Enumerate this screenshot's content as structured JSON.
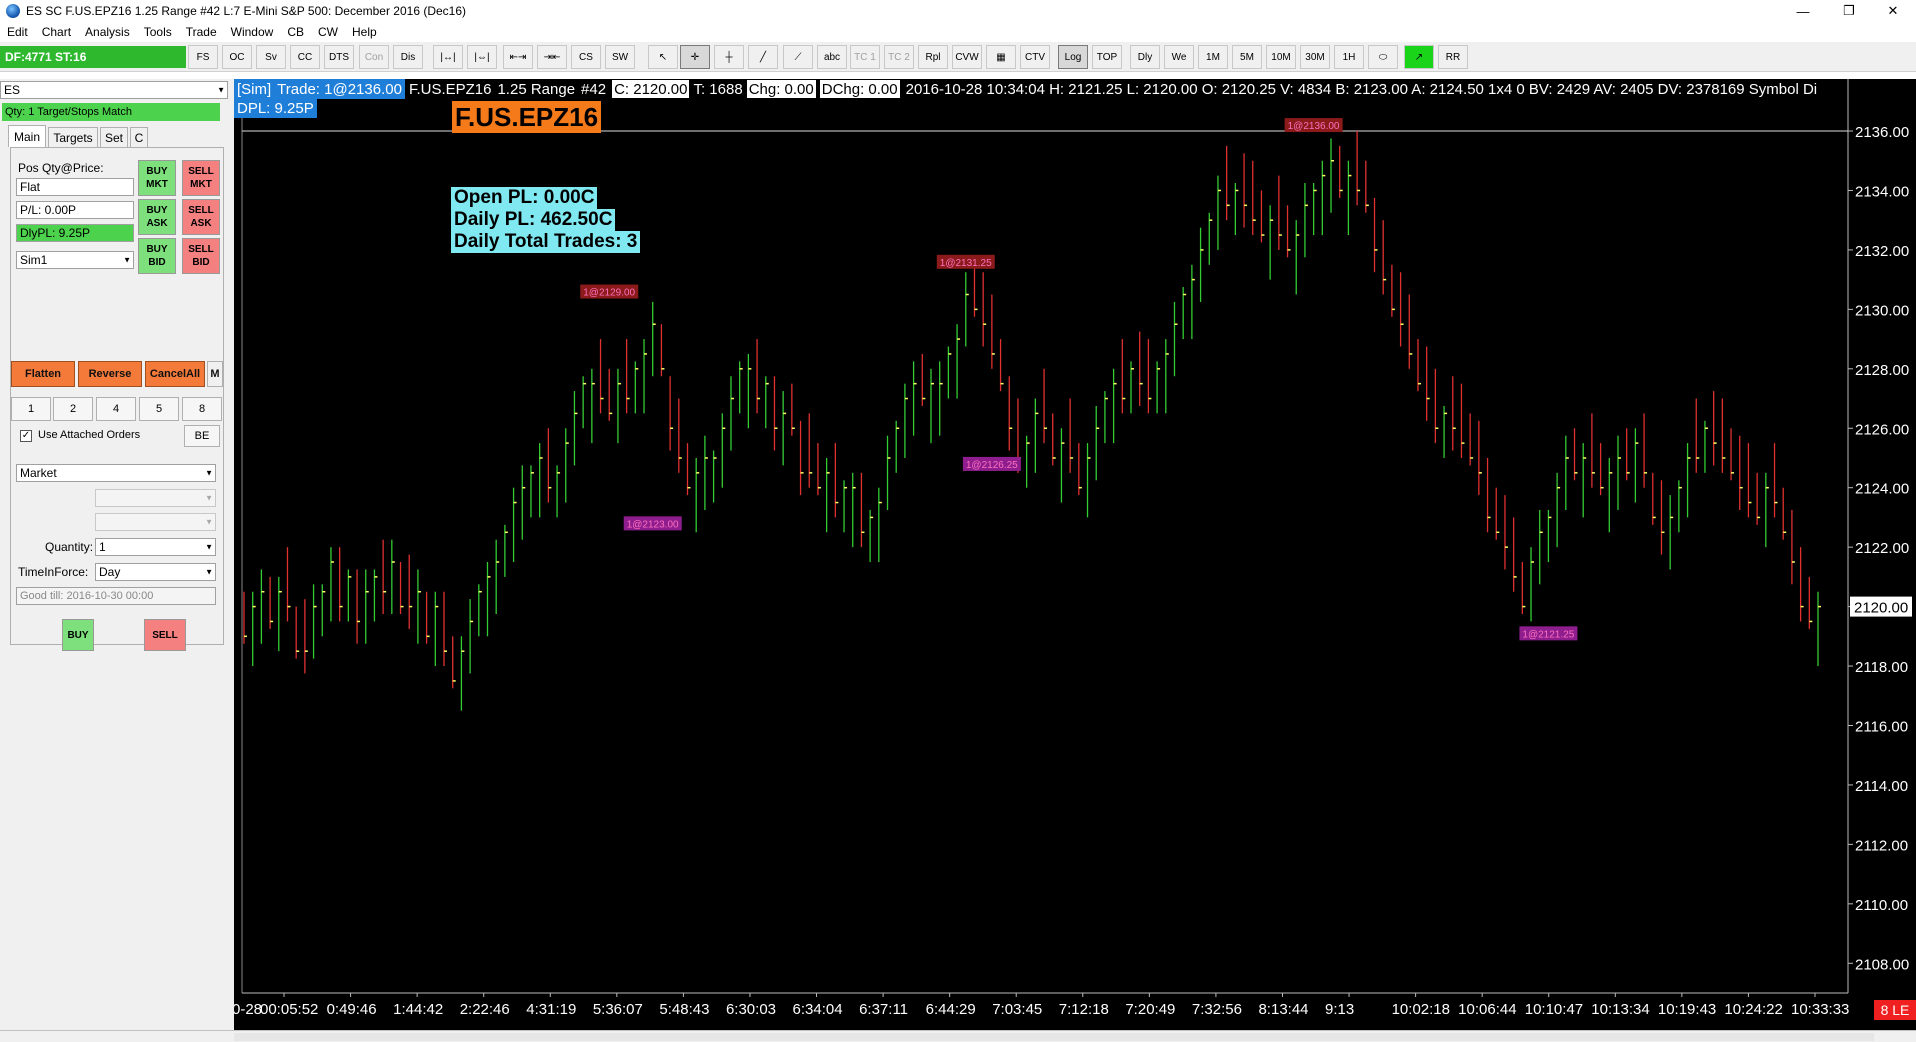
{
  "window": {
    "title": "ES  SC F.US.EPZ16  1.25 Range  #42  L:7  E-Mini S&P 500: December 2016 (Dec16)",
    "controls": [
      "—",
      "❐",
      "✕"
    ]
  },
  "menu": [
    "Edit",
    "Chart",
    "Analysis",
    "Tools",
    "Trade",
    "Window",
    "CB",
    "CW",
    "Help"
  ],
  "toolbar": {
    "status": "DF:4771  ST:16",
    "buttons": [
      {
        "label": "FS",
        "state": "normal"
      },
      {
        "label": "OC",
        "state": "normal"
      },
      {
        "label": "Sv",
        "state": "normal"
      },
      {
        "label": "CC",
        "state": "normal"
      },
      {
        "label": "DTS",
        "state": "normal"
      },
      {
        "label": "Con",
        "state": "disabled"
      },
      {
        "label": "Dis",
        "state": "normal"
      },
      {
        "label": "|↔|",
        "state": "normal"
      },
      {
        "label": "|⇔|",
        "state": "normal"
      },
      {
        "label": "⇤⇥",
        "state": "normal"
      },
      {
        "label": "⇥⇤",
        "state": "normal"
      },
      {
        "label": "CS",
        "state": "normal"
      },
      {
        "label": "SW",
        "state": "normal"
      },
      {
        "label": "↖",
        "state": "normal"
      },
      {
        "label": "✛",
        "state": "active"
      },
      {
        "label": "┼",
        "state": "normal"
      },
      {
        "label": "╱",
        "state": "normal"
      },
      {
        "label": "⟋",
        "state": "normal"
      },
      {
        "label": "abc",
        "state": "normal"
      },
      {
        "label": "TC 1",
        "state": "disabled"
      },
      {
        "label": "TC 2",
        "state": "disabled"
      },
      {
        "label": "Rpl",
        "state": "normal"
      },
      {
        "label": "CVW",
        "state": "normal"
      },
      {
        "label": "▦",
        "state": "normal"
      },
      {
        "label": "CTV",
        "state": "normal"
      },
      {
        "label": "Log",
        "state": "active"
      },
      {
        "label": "TOP",
        "state": "normal"
      },
      {
        "label": "Dly",
        "state": "normal"
      },
      {
        "label": "We",
        "state": "normal"
      },
      {
        "label": "1M",
        "state": "normal"
      },
      {
        "label": "5M",
        "state": "normal"
      },
      {
        "label": "10M",
        "state": "normal"
      },
      {
        "label": "30M",
        "state": "normal"
      },
      {
        "label": "1H",
        "state": "normal"
      },
      {
        "label": "⬭",
        "state": "normal"
      },
      {
        "label": "↗",
        "state": "green"
      },
      {
        "label": "RR",
        "state": "normal"
      }
    ]
  },
  "trade_panel": {
    "symbol": "ES",
    "match_status": "Qty: 1 Target/Stops Match",
    "tabs": [
      "Main",
      "Targets",
      "Set",
      "C"
    ],
    "pos_label": "Pos Qty@Price:",
    "pos_value": "Flat",
    "pl_value": "P/L: 0.00P",
    "dly_pl": "DlyPL: 9.25P",
    "account": "Sim1",
    "order_buttons": {
      "buy_mkt": "BUY\nMKT",
      "sell_mkt": "SELL\nMKT",
      "buy_ask": "BUY\nASK",
      "sell_ask": "SELL\nASK",
      "buy_bid": "BUY\nBID",
      "sell_bid": "SELL\nBID"
    },
    "flatten": "Flatten",
    "reverse": "Reverse",
    "cancel_all": "CancelAll",
    "m_label": "M",
    "qty_buttons": [
      "1",
      "2",
      "4",
      "5",
      "8"
    ],
    "use_attached_label": "Use Attached Orders",
    "use_attached_checked": true,
    "be_label": "BE",
    "order_type": "Market",
    "quantity_label": "Quantity:",
    "quantity_value": "1",
    "tif_label": "TimeInForce:",
    "tif_value": "Day",
    "good_till": "Good till: 2016-10-30 00:00",
    "buy": "BUY",
    "sell": "SELL"
  },
  "chart_header": {
    "sim": "[Sim]",
    "trade": "Trade: 1@2136.00",
    "symbol_text": "F.US.EPZ16",
    "range": "1.25 Range",
    "bars": "#42",
    "close": "C: 2120.00",
    "ticks": "T: 1688",
    "chg": "Chg: 0.00",
    "dchg": "DChg: 0.00",
    "rest": "2016-10-28 10:34:04  H: 2121.25  L: 2120.00  O: 2120.25  V: 4834  B: 2123.00  A: 2124.50  1x4 0  BV: 2429  AV: 2405  DV: 2378169  Symbol Di",
    "dpl": "DPL: 9.25P",
    "symbol_label": "F.US.EPZ16",
    "open_pl": "Open PL: 0.00C",
    "daily_pl": "Daily PL: 462.50C",
    "daily_trades": "Daily Total Trades: 3",
    "corner": "8 LE"
  },
  "chart_data": {
    "type": "bar",
    "y_ticks": [
      "2136.00",
      "2134.00",
      "2132.00",
      "2130.00",
      "2128.00",
      "2126.00",
      "2124.00",
      "2122.00",
      "2120.00",
      "2118.00",
      "2116.00",
      "2114.00",
      "2112.00",
      "2110.00",
      "2108.00"
    ],
    "ylim": [
      2107,
      2137.75
    ],
    "price_line": 2136.0,
    "x_ticks": [
      "0-28",
      "00:05:52",
      "0:49:46",
      "1:44:42",
      "2:22:46",
      "4:31:19",
      "5:36:07",
      "5:48:43",
      "6:30:03",
      "6:34:04",
      "6:37:11",
      "6:44:29",
      "7:03:45",
      "7:12:18",
      "7:20:49",
      "7:32:56",
      "8:13:44",
      "9:13",
      "10:02:18",
      "10:06:44",
      "10:10:47",
      "10:13:34",
      "10:19:43",
      "10:24:22",
      "10:33:33"
    ],
    "colors": {
      "up": "#33cc33",
      "down": "#e03030",
      "sell_tag": "#8b1a1a",
      "buy_tag": "#8e1e8e"
    },
    "closes": [
      2119,
      2120,
      2120.5,
      2119.5,
      2120.5,
      2120,
      2118.5,
      2118.5,
      2120,
      2120.5,
      2121.5,
      2120,
      2121,
      2119.5,
      2120.5,
      2121,
      2120.5,
      2121.5,
      2120,
      2120,
      2120.5,
      2119,
      2120,
      2118.5,
      2117.5,
      2118.5,
      2119.5,
      2120.5,
      2121,
      2121.5,
      2122.5,
      2123.5,
      2124,
      2124.5,
      2125,
      2124,
      2124.5,
      2125.5,
      2126.5,
      2127.5,
      2127.5,
      2127,
      2126.5,
      2127.5,
      2127,
      2128,
      2128.5,
      2129.5,
      2128,
      2126,
      2125,
      2124,
      2124.5,
      2125,
      2125,
      2126,
      2127,
      2128,
      2128,
      2127,
      2127.5,
      2126,
      2126.5,
      2126,
      2124.5,
      2124.5,
      2124,
      2124.5,
      2123.5,
      2124,
      2124,
      2122.5,
      2123,
      2123.5,
      2125,
      2126,
      2127,
      2127.5,
      2127,
      2127.5,
      2127.5,
      2128.5,
      2129,
      2130.5,
      2130,
      2129.5,
      2128.5,
      2127.5,
      2126,
      2125,
      2125.5,
      2126.5,
      2126,
      2125,
      2125.5,
      2125,
      2124,
      2125,
      2126,
      2127,
      2127.5,
      2127,
      2128,
      2127.5,
      2127,
      2128,
      2128.5,
      2129.5,
      2130.5,
      2131,
      2132,
      2133,
      2134,
      2133.5,
      2134,
      2133.5,
      2133,
      2132.5,
      2133,
      2132.5,
      2132,
      2132.5,
      2133.5,
      2134,
      2134.5,
      2135,
      2134,
      2134.5,
      2134,
      2133.5,
      2132,
      2131,
      2130,
      2129.5,
      2128.5,
      2127.5,
      2127,
      2126,
      2126.5,
      2126,
      2125.5,
      2125,
      2124.5,
      2123,
      2122.5,
      2122,
      2121,
      2120,
      2121.5,
      2122.5,
      2123,
      2124,
      2125,
      2124.5,
      2125,
      2124.5,
      2124,
      2124.5,
      2125,
      2124.5,
      2125.5,
      2124.5,
      2123,
      2122.5,
      2123,
      2124,
      2125,
      2125,
      2126,
      2125.5,
      2125,
      2124.5,
      2124,
      2123.5,
      2123,
      2124,
      2123.5,
      2122.5,
      2121.5,
      2120,
      2119.5,
      2120
    ],
    "trade_markers": [
      {
        "label": "1@2136.00",
        "kind": "sell",
        "bar": 123,
        "price": 2136.2
      },
      {
        "label": "1@2129.00",
        "kind": "sell",
        "bar": 42,
        "price": 2130.6
      },
      {
        "label": "1@2131.25",
        "kind": "sell",
        "bar": 83,
        "price": 2131.6
      },
      {
        "label": "1@2123.00",
        "kind": "buy",
        "bar": 47,
        "price": 2122.8
      },
      {
        "label": "1@2126.25",
        "kind": "buy",
        "bar": 86,
        "price": 2124.8
      },
      {
        "label": "1@2121.25",
        "kind": "buy",
        "bar": 150,
        "price": 2119.1
      }
    ]
  }
}
